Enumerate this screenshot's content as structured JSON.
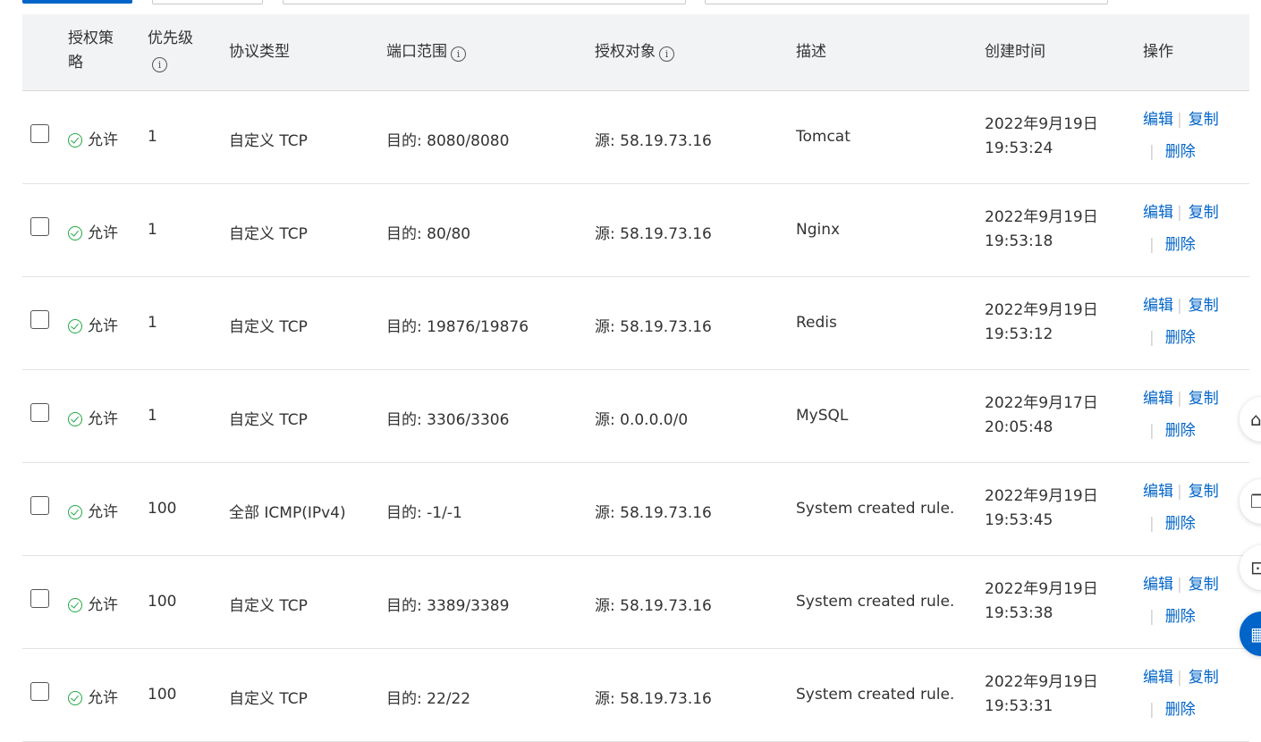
{
  "header": {
    "col_policy": "授权策略",
    "col_policy_line1": "授权策",
    "col_policy_line2": "略",
    "col_priority": "优先级",
    "col_protocol": "协议类型",
    "col_port": "端口范围",
    "col_target": "授权对象",
    "col_desc": "描述",
    "col_created": "创建时间",
    "col_ops": "操作"
  },
  "actions": {
    "edit": "编辑",
    "copy": "复制",
    "delete": "删除",
    "separator": "|"
  },
  "rows": [
    {
      "policy": "允许",
      "priority": "1",
      "protocol": "自定义 TCP",
      "port": "目的: 8080/8080",
      "target": "源: 58.19.73.16",
      "desc": "Tomcat",
      "date": "2022年9月19日",
      "time": "19:53:24"
    },
    {
      "policy": "允许",
      "priority": "1",
      "protocol": "自定义 TCP",
      "port": "目的: 80/80",
      "target": "源: 58.19.73.16",
      "desc": "Nginx",
      "date": "2022年9月19日",
      "time": "19:53:18"
    },
    {
      "policy": "允许",
      "priority": "1",
      "protocol": "自定义 TCP",
      "port": "目的: 19876/19876",
      "target": "源: 58.19.73.16",
      "desc": "Redis",
      "date": "2022年9月19日",
      "time": "19:53:12"
    },
    {
      "policy": "允许",
      "priority": "1",
      "protocol": "自定义 TCP",
      "port": "目的: 3306/3306",
      "target": "源: 0.0.0.0/0",
      "desc": "MySQL",
      "date": "2022年9月17日",
      "time": "20:05:48"
    },
    {
      "policy": "允许",
      "priority": "100",
      "protocol": "全部 ICMP(IPv4)",
      "port": "目的: -1/-1",
      "target": "源: 58.19.73.16",
      "desc": "System created rule.",
      "date": "2022年9月19日",
      "time": "19:53:45"
    },
    {
      "policy": "允许",
      "priority": "100",
      "protocol": "自定义 TCP",
      "port": "目的: 3389/3389",
      "target": "源: 58.19.73.16",
      "desc": "System created rule.",
      "date": "2022年9月19日",
      "time": "19:53:38"
    },
    {
      "policy": "允许",
      "priority": "100",
      "protocol": "自定义 TCP",
      "port": "目的: 22/22",
      "target": "源: 58.19.73.16",
      "desc": "System created rule.",
      "date": "2022年9月19日",
      "time": "19:53:31"
    }
  ],
  "icons": {
    "info": "info-icon",
    "allow": "check-circle-icon",
    "float_1": "home-icon",
    "float_2": "copy-icon",
    "float_3": "code-icon",
    "float_4": "grid-icon"
  },
  "colors": {
    "primary": "#0064c8",
    "allow_green": "#22a844",
    "header_bg": "#f2f3f5"
  }
}
